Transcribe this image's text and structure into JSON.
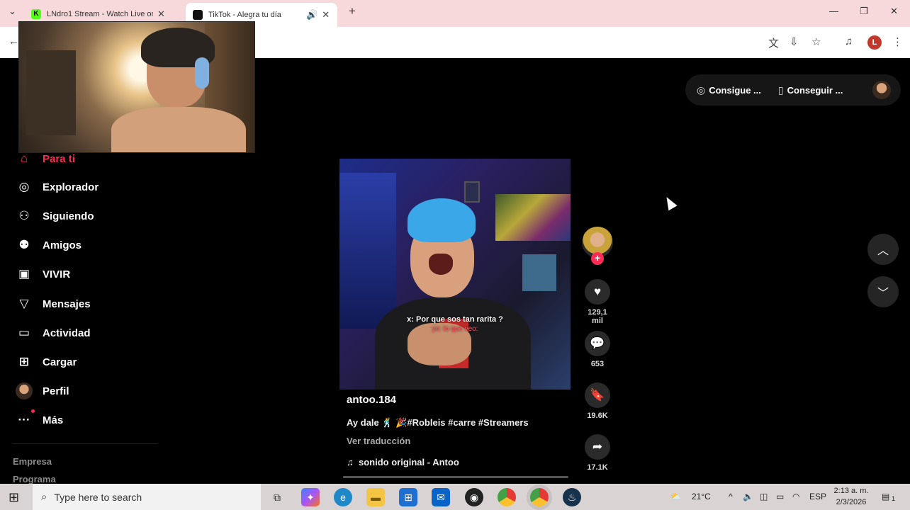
{
  "browser": {
    "tabs": [
      {
        "title": "LNdro1 Stream - Watch Live on",
        "active": false,
        "favicon_color": "#53fc18"
      },
      {
        "title": "TikTok - Alegra tu día",
        "active": true,
        "favicon_color": "#000000"
      }
    ],
    "new_tab_glyph": "+",
    "profile_initial": "L"
  },
  "tiktok": {
    "nav": [
      {
        "label": "Para ti",
        "icon": "home-icon",
        "active": true
      },
      {
        "label": "Explorador",
        "icon": "compass-icon"
      },
      {
        "label": "Siguiendo",
        "icon": "user-follow-icon"
      },
      {
        "label": "Amigos",
        "icon": "friends-icon"
      },
      {
        "label": "VIVIR",
        "icon": "live-tv-icon"
      },
      {
        "label": "Mensajes",
        "icon": "send-icon"
      },
      {
        "label": "Actividad",
        "icon": "inbox-icon"
      },
      {
        "label": "Cargar",
        "icon": "upload-icon"
      },
      {
        "label": "Perfil",
        "icon": "profile-avatar"
      },
      {
        "label": "Más",
        "icon": "more-icon"
      }
    ],
    "footer": {
      "company": "Empresa",
      "program": "Programa"
    },
    "top_actions": {
      "get_coins": "Consigue ...",
      "get_app": "Conseguir ..."
    },
    "video": {
      "author": "antoo.184",
      "caption": "Ay dale 🕺 🎉#Robleis #carre #Streamers",
      "translate": "Ver traducción",
      "sound": "sonido original - Antoo",
      "overlay_line1": "x: Por que sos tan rarita ?",
      "overlay_line2": "yo: lo que veo:"
    },
    "actions": {
      "likes": "129,1 mil",
      "comments": "653",
      "saves": "19.6K",
      "shares": "17.1K"
    },
    "accent": "#fe2c55"
  },
  "taskbar": {
    "search_placeholder": "Type here to search",
    "weather": "21°C",
    "language": "ESP",
    "time": "2:13 a. m.",
    "date": "2/3/2026",
    "notification_count": "1"
  }
}
